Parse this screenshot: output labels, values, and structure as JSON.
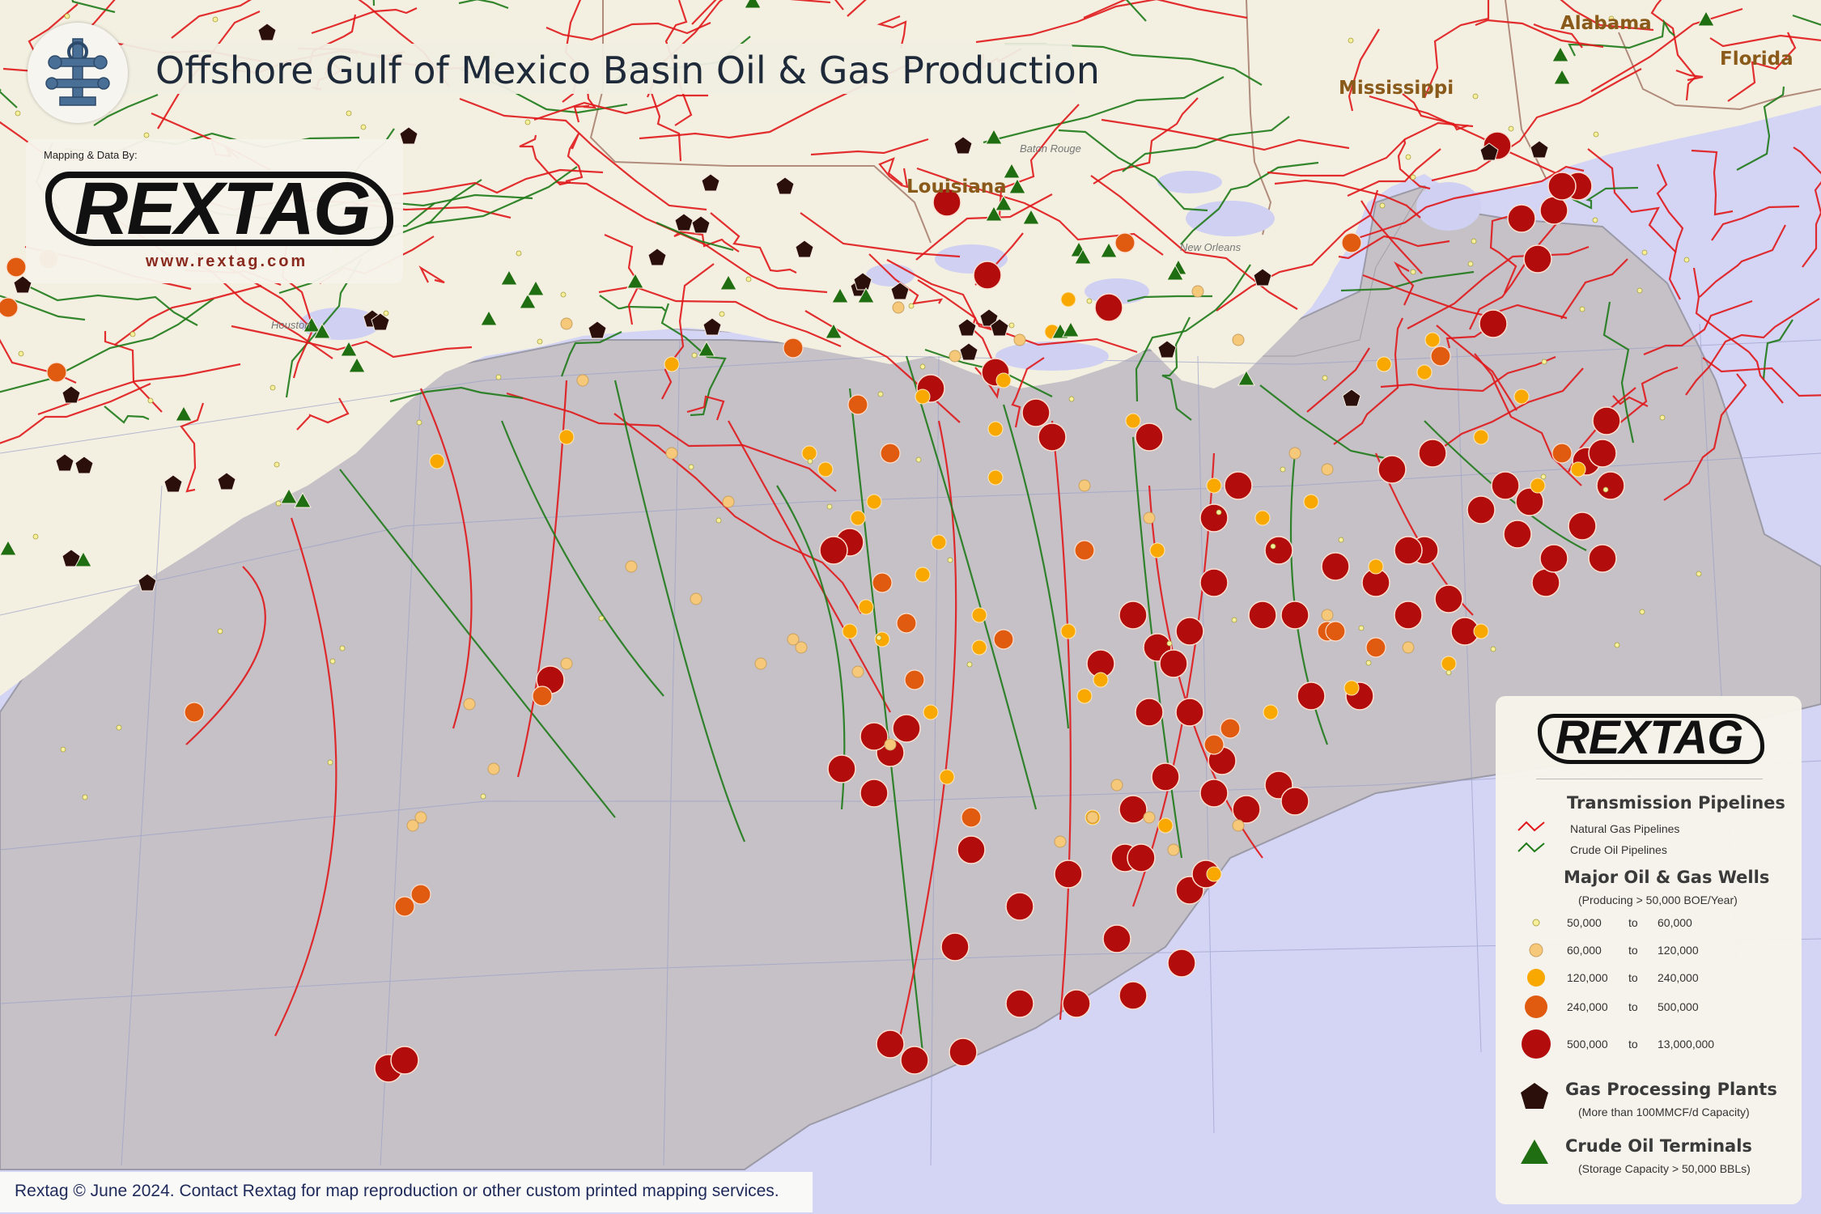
{
  "title": "Offshore Gulf of Mexico Basin Oil & Gas Production",
  "brand": {
    "mapping_credit": "Mapping & Data By:",
    "logo_text": "REXTAG",
    "url": "www.rextag.com"
  },
  "footer": "Rextag © June 2024. Contact Rextag for map reproduction or other custom printed mapping services.",
  "state_labels": [
    "Alabama",
    "Florida",
    "Mississippi",
    "Louisiana"
  ],
  "city_labels": [
    "Baton Rouge",
    "New Orleans",
    "Houston"
  ],
  "legend": {
    "logo_text": "REXTAG",
    "pipelines_heading": "Transmission Pipelines",
    "gas_pipelines": "Natural Gas Pipelines",
    "crude_pipelines": "Crude Oil  Pipelines",
    "wells_heading": "Major Oil & Gas Wells",
    "wells_sub": "(Producing > 50,000 BOE/Year)",
    "ranges": [
      {
        "from": "50,000",
        "to_word": "to",
        "to": "60,000"
      },
      {
        "from": "60,000",
        "to_word": "to",
        "to": "120,000"
      },
      {
        "from": "120,000",
        "to_word": "to",
        "to": "240,000"
      },
      {
        "from": "240,000",
        "to_word": "to",
        "to": "500,000"
      },
      {
        "from": "500,000",
        "to_word": "to",
        "to": "13,000,000"
      }
    ],
    "plants_heading": "Gas Processing Plants",
    "plants_sub": "(More than 100MMCF/d Capacity)",
    "terminals_heading": "Crude Oil Terminals",
    "terminals_sub": "(Storage Capacity > 50,000 BBLs)"
  },
  "colors": {
    "gas_pipeline": "#e0181b",
    "crude_pipeline": "#1f7a1a",
    "well_tiny": "#f7f09a",
    "well_small": "#f6c97a",
    "well_medium": "#f8a800",
    "well_large": "#e05a10",
    "well_xlarge": "#b30c0c",
    "plant": "#2a0f0a",
    "terminal": "#1f6e12",
    "land": "#f3f0e1",
    "water": "#d4d5f5",
    "shelf": "#c8c3c8"
  },
  "icons": [
    "oil-rig-icon"
  ]
}
